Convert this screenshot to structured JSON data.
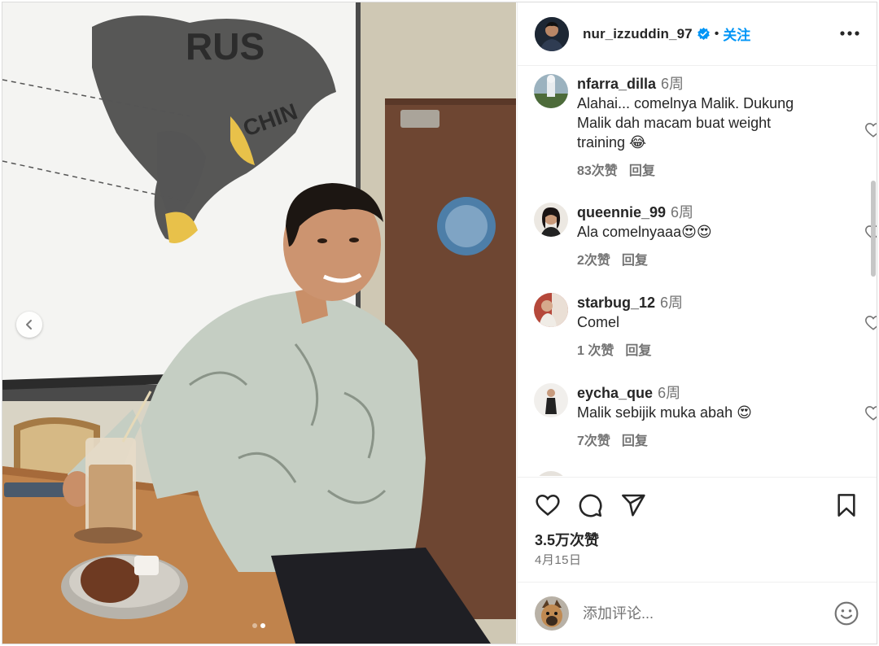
{
  "post": {
    "username": "nur_izzuddin_97",
    "separator": "•",
    "follow_label": "关注",
    "likes": "3.5万次赞",
    "date": "4月15日"
  },
  "comments": [
    {
      "user": "nfarra_dilla",
      "time": "6周",
      "lines": [
        "Alahai... comelnya Malik. Dukung",
        "Malik dah macam buat weight",
        "training 😂"
      ],
      "likes": "83次赞",
      "reply": "回复"
    },
    {
      "user": "queennie_99",
      "time": "6周",
      "lines": [
        "Ala comelnyaaa😍😍"
      ],
      "likes": "2次赞",
      "reply": "回复"
    },
    {
      "user": "starbug_12",
      "time": "6周",
      "lines": [
        "Comel"
      ],
      "likes": "1 次赞",
      "reply": "回复"
    },
    {
      "user": "eycha_que",
      "time": "6周",
      "lines": [
        "Malik sebijik muka abah 😍"
      ],
      "likes": "7次赞",
      "reply": "回复"
    }
  ],
  "add_comment": {
    "placeholder": "添加评论..."
  },
  "carousel": {
    "count": 2,
    "active_index": 1
  },
  "colors": {
    "accent": "#0095f6",
    "verified": "#0095f6",
    "text": "#262626",
    "muted": "#737373"
  },
  "icons": [
    "verified-badge-icon",
    "more-options-icon",
    "heart-icon",
    "comment-icon",
    "share-icon",
    "bookmark-icon",
    "emoji-icon",
    "chevron-left-icon"
  ]
}
